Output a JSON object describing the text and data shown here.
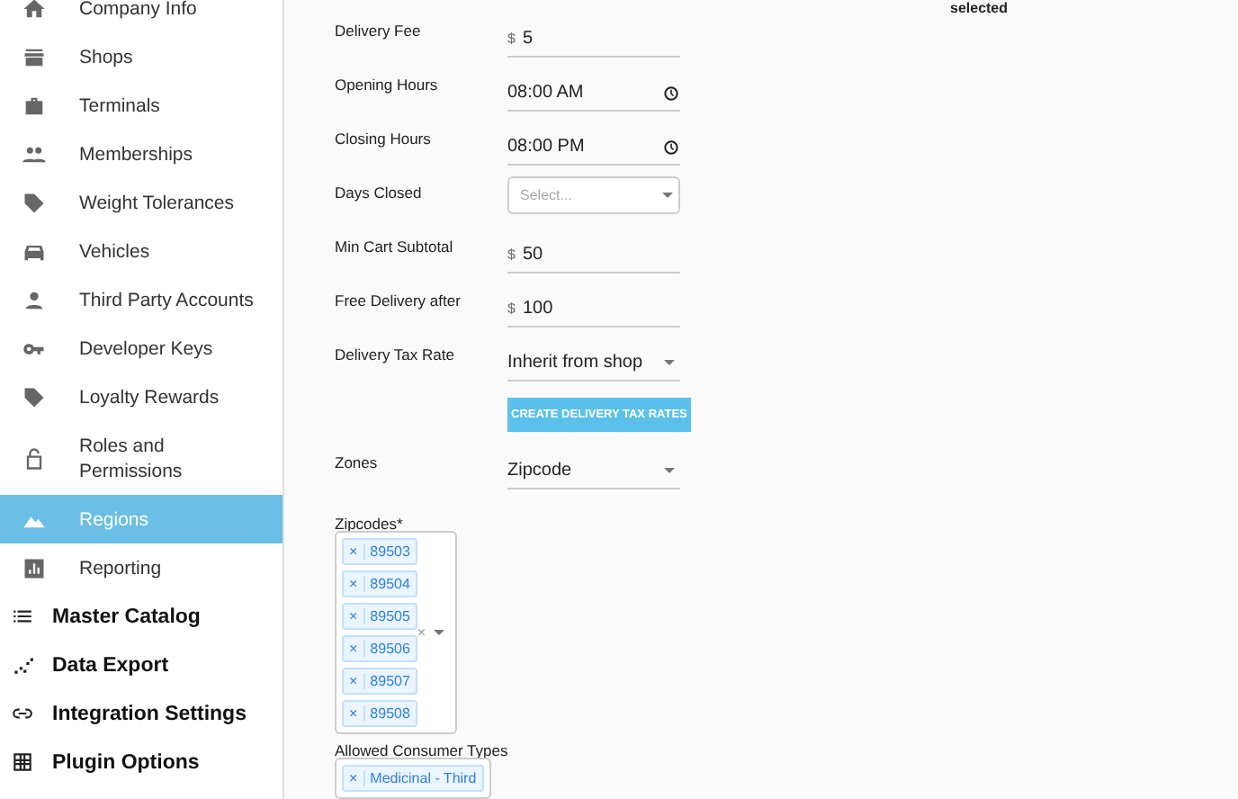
{
  "sidebar": {
    "items": [
      {
        "label": "Company Info",
        "kind": "sub",
        "selected": false
      },
      {
        "label": "Shops",
        "kind": "sub",
        "selected": false
      },
      {
        "label": "Terminals",
        "kind": "sub",
        "selected": false
      },
      {
        "label": "Memberships",
        "kind": "sub",
        "selected": false
      },
      {
        "label": "Weight Tolerances",
        "kind": "sub",
        "selected": false
      },
      {
        "label": "Vehicles",
        "kind": "sub",
        "selected": false
      },
      {
        "label": "Third Party Accounts",
        "kind": "sub",
        "selected": false
      },
      {
        "label": "Developer Keys",
        "kind": "sub",
        "selected": false
      },
      {
        "label": "Loyalty Rewards",
        "kind": "sub",
        "selected": false
      },
      {
        "label": "Roles and Permissions",
        "kind": "sub",
        "selected": false
      },
      {
        "label": "Regions",
        "kind": "sub",
        "selected": true
      },
      {
        "label": "Reporting",
        "kind": "sub",
        "selected": false
      },
      {
        "label": "Master Catalog",
        "kind": "main",
        "selected": false
      },
      {
        "label": "Data Export",
        "kind": "main",
        "selected": false
      },
      {
        "label": "Integration Settings",
        "kind": "main",
        "selected": false
      },
      {
        "label": "Plugin Options",
        "kind": "main",
        "selected": false
      }
    ]
  },
  "top_note": "selected",
  "form": {
    "rows": [
      {
        "kind": "money",
        "label": "Delivery Fee",
        "prefix": "$",
        "value": "5"
      },
      {
        "kind": "time",
        "label": "Opening Hours",
        "value": "08:00 AM"
      },
      {
        "kind": "time",
        "label": "Closing Hours",
        "value": "08:00 PM"
      },
      {
        "kind": "select",
        "label": "Days Closed",
        "placeholder": "Select..."
      },
      {
        "kind": "money",
        "label": "Min Cart Subtotal",
        "prefix": "$",
        "value": "50"
      },
      {
        "kind": "money",
        "label": "Free Delivery after",
        "prefix": "$",
        "value": "100"
      },
      {
        "kind": "dropdown",
        "label": "Delivery Tax Rate",
        "value": "Inherit from shop"
      },
      {
        "kind": "button",
        "label": "CREATE DELIVERY TAX RATES"
      },
      {
        "kind": "dropdown",
        "label": "Zones",
        "value": "Zipcode"
      },
      {
        "kind": "tags",
        "label": "Zipcodes*",
        "tags": [
          {
            "remove": "×",
            "text": "89503"
          },
          {
            "remove": "×",
            "text": "89504"
          },
          {
            "remove": "×",
            "text": "89505"
          },
          {
            "remove": "×",
            "text": "89506"
          },
          {
            "remove": "×",
            "text": "89507"
          },
          {
            "remove": "×",
            "text": "89508"
          }
        ],
        "clear": "×"
      },
      {
        "kind": "tags",
        "label": "Allowed Consumer Types",
        "tags": [
          {
            "remove": "×",
            "text": "Medicinal - Third"
          }
        ]
      }
    ]
  }
}
